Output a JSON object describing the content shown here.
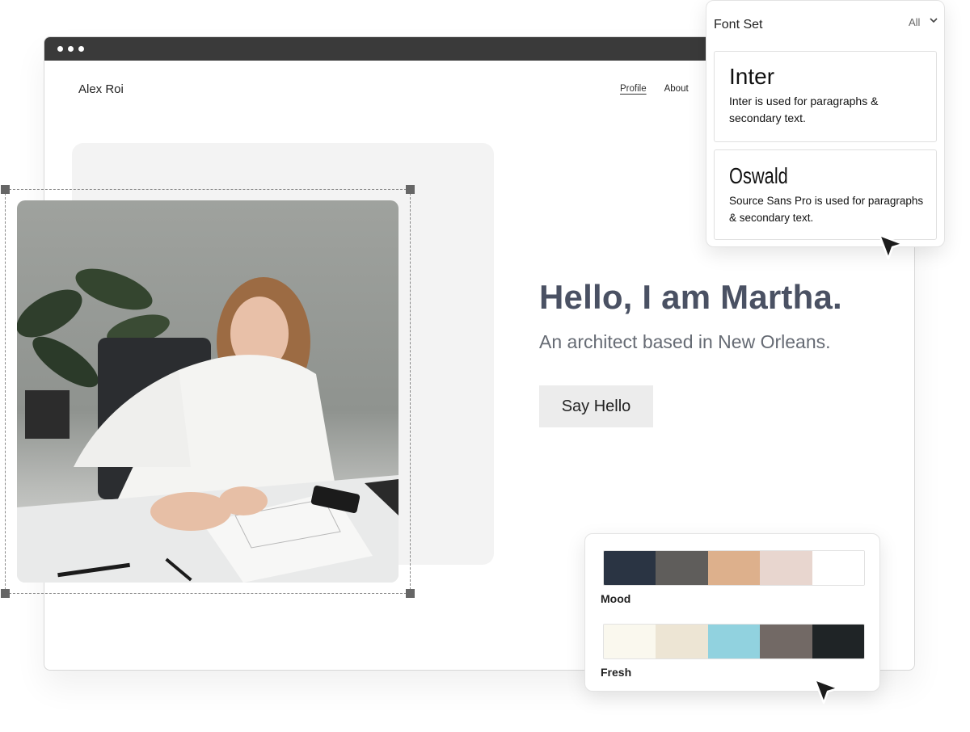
{
  "site": {
    "title": "Alex Roi",
    "nav": [
      {
        "label": "Profile",
        "active": true
      },
      {
        "label": "About",
        "active": false
      }
    ]
  },
  "hero": {
    "headline": "Hello, I am Martha.",
    "subline": "An architect based in New Orleans.",
    "cta_label": "Say Hello"
  },
  "font_panel": {
    "title": "Font Set",
    "filter_label": "All",
    "fonts": [
      {
        "name": "Inter",
        "description": "Inter is used for paragraphs & secondary text."
      },
      {
        "name": "Oswald",
        "description": "Source Sans Pro is used for paragraphs & secondary text."
      }
    ]
  },
  "palette_panel": {
    "palettes": [
      {
        "name": "Mood",
        "colors": [
          "#2a3443",
          "#5f5d5b",
          "#ddb08c",
          "#e8d6cf",
          "#ffffff"
        ]
      },
      {
        "name": "Fresh",
        "colors": [
          "#faf8ee",
          "#ede5d4",
          "#91d2df",
          "#726965",
          "#1f2426"
        ]
      }
    ]
  },
  "colors": {
    "browser_bar": "#3a3a3a",
    "headline": "#4a5163",
    "cta_bg": "#ececec"
  }
}
